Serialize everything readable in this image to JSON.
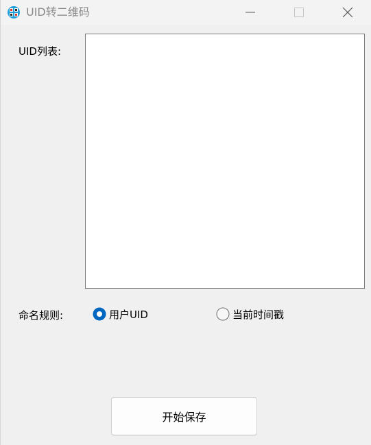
{
  "window": {
    "title": "UID转二维码",
    "icon": "app-grid-icon",
    "controls": {
      "minimize_icon": "minimize-icon",
      "maximize_icon": "maximize-icon",
      "close_icon": "close-icon"
    }
  },
  "form": {
    "uid_list_label": "UID列表:",
    "uid_list_value": "",
    "naming_rule_label": "命名规则:",
    "naming_options": [
      {
        "label": "用户UID",
        "selected": true
      },
      {
        "label": "当前时间戳",
        "selected": false
      }
    ],
    "start_button_label": "开始保存"
  },
  "colors": {
    "accent": "#0067c0",
    "window_bg": "#f0f0f0",
    "title_text": "#8a8a8a"
  }
}
